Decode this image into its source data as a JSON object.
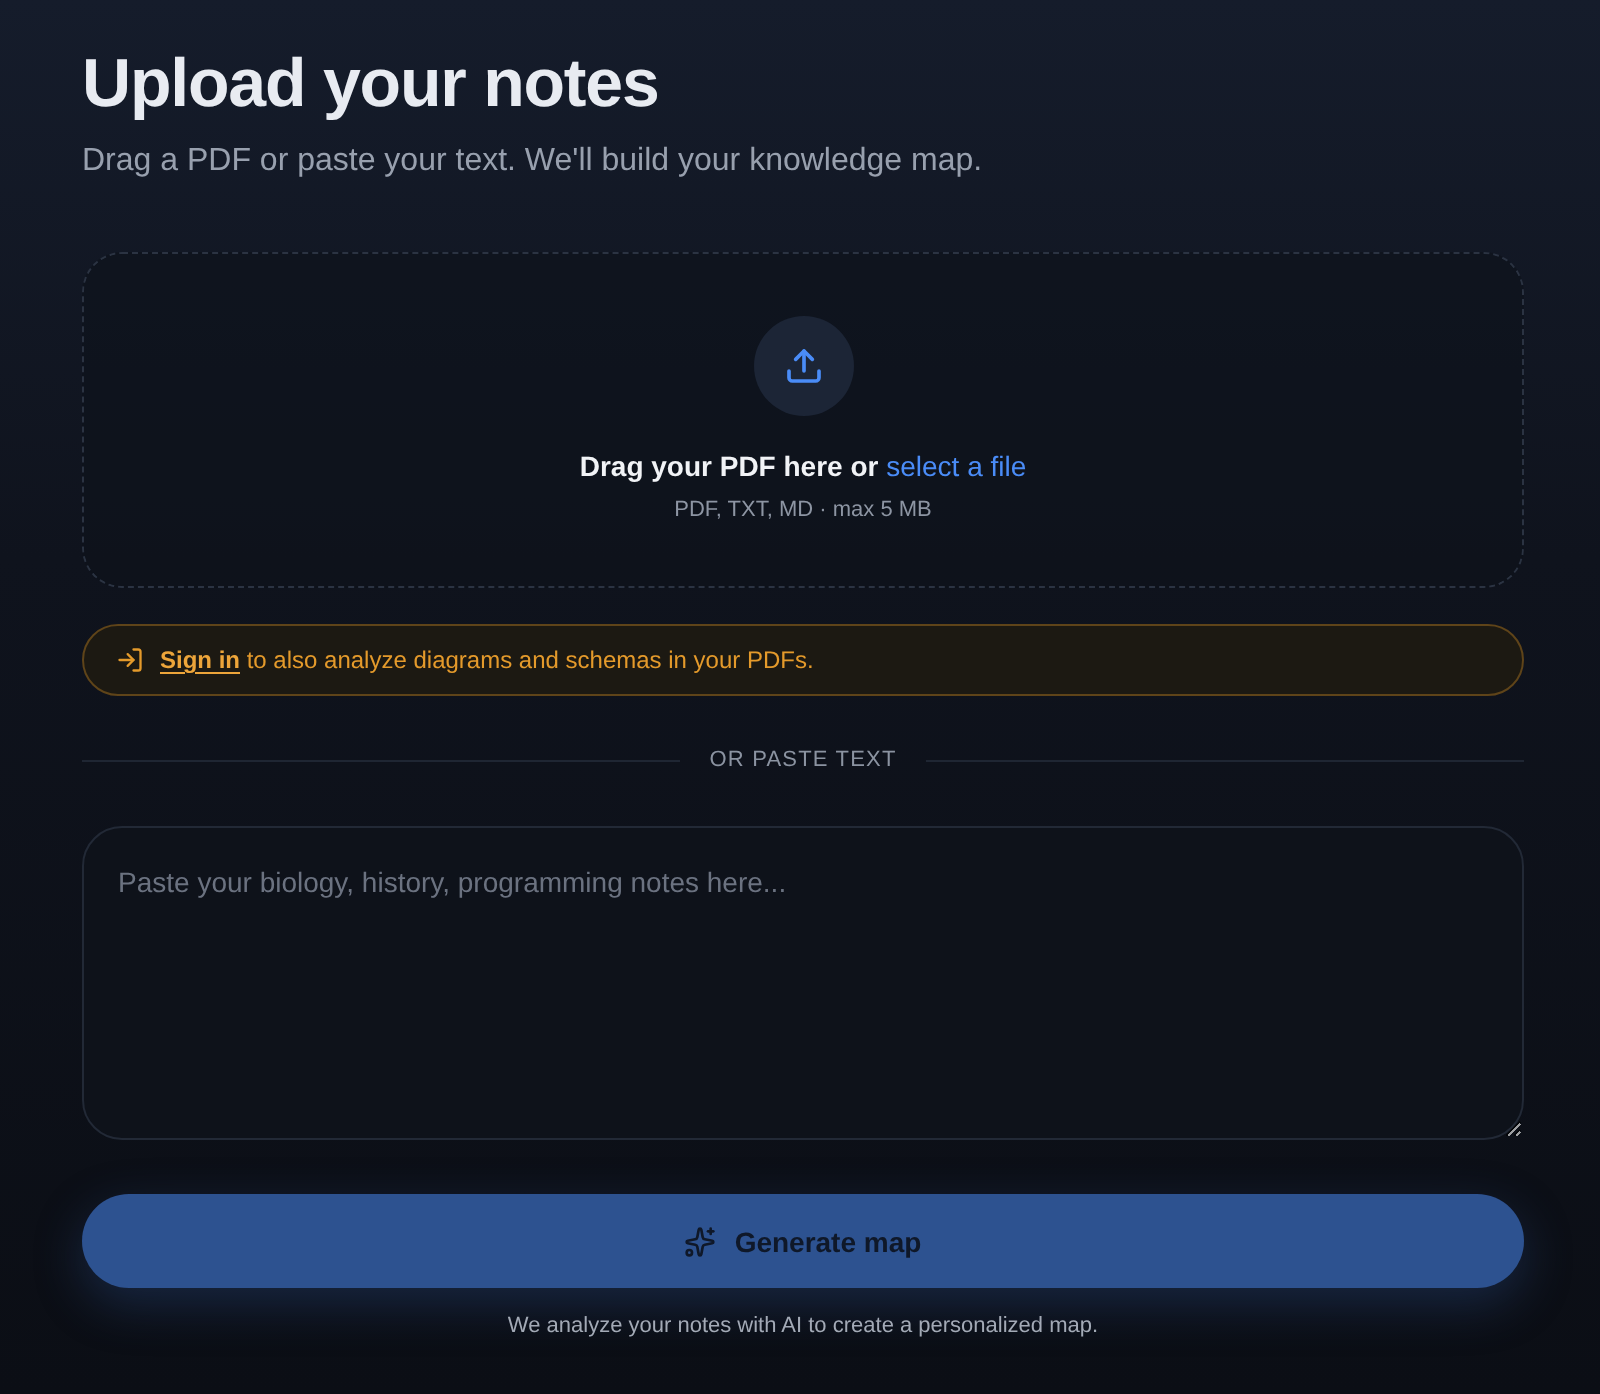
{
  "header": {
    "title": "Upload your notes",
    "subtitle": "Drag a PDF or paste your text. We'll build your knowledge map."
  },
  "dropzone": {
    "prompt": "Drag your PDF here or",
    "link": "select a file",
    "hint": "PDF, TXT, MD · max 5 MB"
  },
  "notice": {
    "link": "Sign in",
    "text": "to also analyze diagrams and schemas in your PDFs."
  },
  "divider": {
    "label": "OR PASTE TEXT"
  },
  "notes_field": {
    "placeholder": "Paste your biology, history, programming notes here..."
  },
  "generate_button": {
    "label": "Generate map"
  },
  "footnote": "We analyze your notes with AI to create a personalized map."
}
